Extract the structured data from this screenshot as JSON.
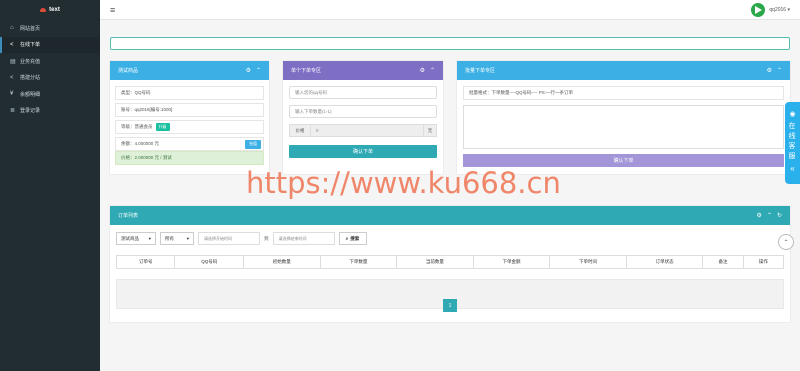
{
  "brand": {
    "name": "text"
  },
  "sidebar": {
    "items": [
      {
        "label": "网站首页",
        "icon": "home-icon",
        "glyph": "⌂"
      },
      {
        "label": "在线下单",
        "icon": "share-icon",
        "glyph": "<"
      },
      {
        "label": "业务充值",
        "icon": "briefcase-icon",
        "glyph": "▤"
      },
      {
        "label": "搭建分站",
        "icon": "share-icon",
        "glyph": "<"
      },
      {
        "label": "余额明细",
        "icon": "yen-icon",
        "glyph": "¥"
      },
      {
        "label": "登录记录",
        "icon": "list-icon",
        "glyph": "≣"
      }
    ]
  },
  "topbar": {
    "menu_glyph": "≡",
    "username": "qq2016 ▾"
  },
  "panel_product": {
    "title": "测试商品",
    "type_line": "类型：QQ号码",
    "account_line": "账号：qq2016[编号:1000]",
    "level_label": "等级：普通会员",
    "upgrade_label": "升级",
    "balance_line": "余额：4.000000 元",
    "recharge_label": "充值",
    "price_line": "价格：2.000000 元 / 测试"
  },
  "panel_single": {
    "title": "单个下单专区",
    "qq_placeholder": "输入您的qq号码",
    "qty_placeholder": "输入下单数量(1-1)",
    "price_label": "价格",
    "price_value": "0",
    "price_unit": "元",
    "submit_label": "确认下单"
  },
  "panel_batch": {
    "title": "批量下单专区",
    "format_hint": "批量格式：下单数量----QQ号码----  PS:一行一条订单",
    "submit_label": "确认下单"
  },
  "orders": {
    "title": "订单列表",
    "filter_product": "测试商品",
    "filter_status": "所有",
    "start_placeholder": "请选择开始时间",
    "range_sep": "到",
    "end_placeholder": "请选择结束时间",
    "search_label": "搜索",
    "columns": [
      "订单号",
      "QQ号码",
      "初始数量",
      "下单数量",
      "当前数量",
      "下单金额",
      "下单时间",
      "订单状态",
      "备注",
      "操作"
    ],
    "page": "1"
  },
  "side_widget": {
    "text": "在线客服",
    "arrow": "«"
  },
  "watermark": "https://www.ku668.cn",
  "colors": {
    "sidebar": "#222d32",
    "blue": "#3cb0e5",
    "purple": "#7e6fc4",
    "teal": "#2fa9b4"
  }
}
